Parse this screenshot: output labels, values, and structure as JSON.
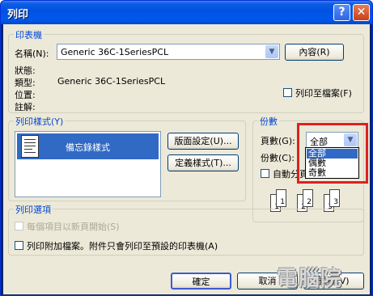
{
  "window": {
    "title": "列印",
    "help_glyph": "?",
    "close_glyph": "✕"
  },
  "printer_group": {
    "label": "印表機",
    "name_label": "名稱(N):",
    "name_value": "Generic 36C-1SeriesPCL",
    "properties_button": "內容(R)",
    "status_label": "狀態:",
    "type_label": "類型:",
    "type_value": "Generic 36C-1SeriesPCL",
    "location_label": "位置:",
    "comment_label": "註解:",
    "print_to_file": "列印至檔案(F)"
  },
  "style_group": {
    "label": "列印樣式(Y)",
    "styles": [
      "備忘錄樣式"
    ],
    "page_setup_button": "版面設定(U)...",
    "define_styles_button": "定義樣式(T)..."
  },
  "copies_group": {
    "label": "份數",
    "pages_label": "頁數(G):",
    "pages_value": "全部",
    "copies_label": "份數(C):",
    "collate_label": "自動分頁(O)",
    "pages_options": [
      "全部",
      "偶數",
      "奇數"
    ],
    "collate_pages": [
      "1",
      "1",
      "2",
      "2",
      "3",
      "3"
    ]
  },
  "print_options_group": {
    "label": "列印選項",
    "new_page_each_item": "每個項目以新頁開始(S)",
    "print_attachments": "列印附加檔案。附件只會列印至預設的印表機(A)"
  },
  "footer": {
    "ok_button": "確定",
    "cancel_button": "取消",
    "preview_button": "預覽(V)"
  },
  "watermark": "電腦院",
  "colors": {
    "titlebar": "#0058ec",
    "dialog_bg": "#ece9d8",
    "group_label": "#0046d5",
    "selection": "#316ac5",
    "highlight": "#e02020"
  }
}
